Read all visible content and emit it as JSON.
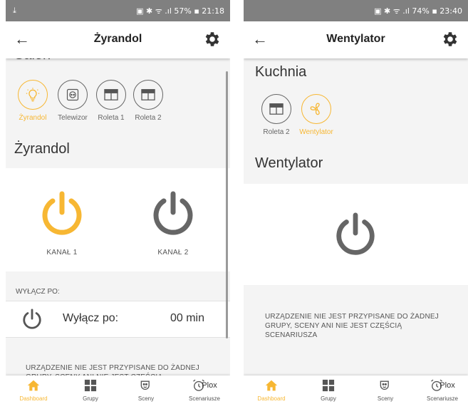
{
  "colors": {
    "accent": "#f7b733",
    "inactive": "#666666",
    "statusbar": "#808080"
  },
  "left": {
    "status": {
      "left_icon": "download-icon",
      "right_text": "57% ▪ 21:18"
    },
    "title": "Żyrandol",
    "room": "Salon",
    "devices": [
      {
        "label": "Żyrandol",
        "icon": "bulb-icon",
        "active": true
      },
      {
        "label": "Telewizor",
        "icon": "socket-icon",
        "active": false
      },
      {
        "label": "Roleta 1",
        "icon": "blind-icon",
        "active": false
      },
      {
        "label": "Roleta 2",
        "icon": "blind-icon",
        "active": false
      }
    ],
    "section": "Żyrandol",
    "channels": [
      {
        "label": "KANAŁ 1",
        "state": "on"
      },
      {
        "label": "KANAŁ 2",
        "state": "off"
      }
    ],
    "off_caption": "WYŁĄCZ PO:",
    "off_label": "Wyłącz po:",
    "off_value": "00 min",
    "info": "URZĄDZENIE NIE JEST PRZYPISANE DO ŻADNEJ GRUPY, SCENY ANI NIE JEST CZĘŚCIĄ SCENARIUSZA"
  },
  "right": {
    "status": {
      "right_text": "74% ▪ 23:40"
    },
    "title": "Wentylator",
    "room": "Kuchnia",
    "devices": [
      {
        "label": "Roleta 2",
        "icon": "blind-icon",
        "active": false
      },
      {
        "label": "Wentylator",
        "icon": "fan-icon",
        "active": true
      }
    ],
    "section": "Wentylator",
    "info": "URZĄDZENIE NIE JEST PRZYPISANE DO ŻADNEJ GRUPY, SCENY ANI NIE JEST CZĘŚCIĄ SCENARIUSZA"
  },
  "nav": [
    {
      "label": "Dashboard",
      "icon": "home-icon",
      "active": true
    },
    {
      "label": "Grupy",
      "icon": "grid-icon",
      "active": false
    },
    {
      "label": "Sceny",
      "icon": "masks-icon",
      "active": false
    },
    {
      "label": "Scenariusze",
      "icon": "alarm-clock-icon",
      "active": false,
      "badge": "Plox"
    }
  ]
}
